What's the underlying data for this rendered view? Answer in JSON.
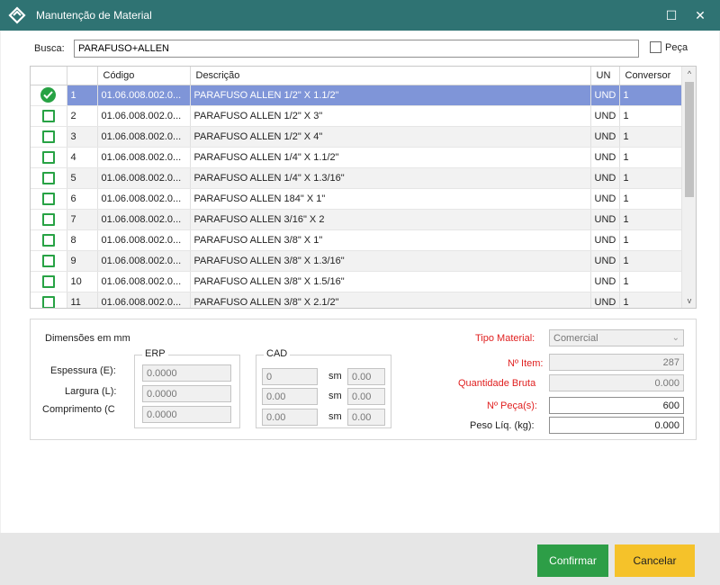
{
  "window": {
    "title": "Manutenção de Material",
    "maximize_glyph": "☐",
    "close_glyph": "✕"
  },
  "search": {
    "label": "Busca:",
    "value": "PARAFUSO+ALLEN",
    "peca_label": "Peça"
  },
  "grid": {
    "columns": [
      "",
      "",
      "Código",
      "Descrição",
      "UN",
      "Conversor"
    ],
    "rows": [
      {
        "checked": true,
        "num": "1",
        "codigo": "01.06.008.002.0...",
        "descricao": "PARAFUSO ALLEN 1/2\" X 1.1/2\"",
        "un": "UND",
        "conversor": "1"
      },
      {
        "checked": false,
        "num": "2",
        "codigo": "01.06.008.002.0...",
        "descricao": "PARAFUSO ALLEN 1/2\" X 3\"",
        "un": "UND",
        "conversor": "1"
      },
      {
        "checked": false,
        "num": "3",
        "codigo": "01.06.008.002.0...",
        "descricao": "PARAFUSO ALLEN 1/2\" X 4\"",
        "un": "UND",
        "conversor": "1"
      },
      {
        "checked": false,
        "num": "4",
        "codigo": "01.06.008.002.0...",
        "descricao": "PARAFUSO ALLEN 1/4\" X 1.1/2\"",
        "un": "UND",
        "conversor": "1"
      },
      {
        "checked": false,
        "num": "5",
        "codigo": "01.06.008.002.0...",
        "descricao": "PARAFUSO ALLEN 1/4\" X 1.3/16\"",
        "un": "UND",
        "conversor": "1"
      },
      {
        "checked": false,
        "num": "6",
        "codigo": "01.06.008.002.0...",
        "descricao": "PARAFUSO ALLEN 184\" X 1\"",
        "un": "UND",
        "conversor": "1"
      },
      {
        "checked": false,
        "num": "7",
        "codigo": "01.06.008.002.0...",
        "descricao": "PARAFUSO ALLEN 3/16\" X 2",
        "un": "UND",
        "conversor": "1"
      },
      {
        "checked": false,
        "num": "8",
        "codigo": "01.06.008.002.0...",
        "descricao": "PARAFUSO ALLEN 3/8\" X 1\"",
        "un": "UND",
        "conversor": "1"
      },
      {
        "checked": false,
        "num": "9",
        "codigo": "01.06.008.002.0...",
        "descricao": "PARAFUSO ALLEN 3/8\" X 1.3/16\"",
        "un": "UND",
        "conversor": "1"
      },
      {
        "checked": false,
        "num": "10",
        "codigo": "01.06.008.002.0...",
        "descricao": "PARAFUSO ALLEN 3/8\" X 1.5/16\"",
        "un": "UND",
        "conversor": "1"
      },
      {
        "checked": false,
        "num": "11",
        "codigo": "01.06.008.002.0...",
        "descricao": "PARAFUSO ALLEN 3/8\" X 2.1/2\"",
        "un": "UND",
        "conversor": "1"
      }
    ],
    "selected_row": 0,
    "scroll_up": "^",
    "scroll_down": "v"
  },
  "dimensions": {
    "title": "Dimensões em mm",
    "labels": {
      "espessura": "Espessura (E):",
      "largura": "Largura (L):",
      "comprimento": "Comprimento (C"
    },
    "erp": {
      "title": "ERP",
      "espessura": "0.0000",
      "largura": "0.0000",
      "comprimento": "0.0000"
    },
    "cad": {
      "title": "CAD",
      "sm_label": "sm",
      "rows": [
        {
          "a": "0",
          "b": "0.00"
        },
        {
          "a": "0.00",
          "b": "0.00"
        },
        {
          "a": "0.00",
          "b": "0.00"
        }
      ]
    }
  },
  "material": {
    "tipo_label": "Tipo Material:",
    "tipo_value": "Comercial",
    "item_label": "Nº Item:",
    "item_value": "287",
    "qtd_bruta_label": "Quantidade Bruta",
    "qtd_bruta_value": "0.000",
    "pecas_label": "Nº Peça(s):",
    "pecas_value": "600",
    "peso_label": "Peso Líq. (kg):",
    "peso_value": "0.000"
  },
  "buttons": {
    "confirm": "Confirmar",
    "cancel": "Cancelar"
  },
  "colors": {
    "titlebar": "#2f7373",
    "selected_row": "#7f95d8",
    "check_green": "#27a244",
    "confirm": "#2d9e47",
    "cancel": "#f5c22a",
    "required_label": "#e02020"
  }
}
